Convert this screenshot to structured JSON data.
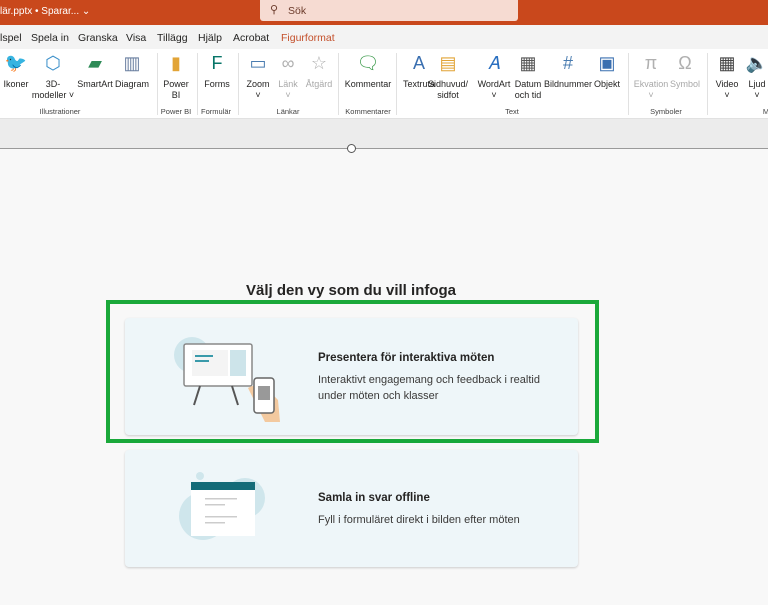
{
  "titlebar": {
    "filename": "lär.pptx • Sparar... ⌄",
    "search_placeholder": "Sök",
    "search_icon": "search-icon"
  },
  "tabs": [
    {
      "label": "lspel"
    },
    {
      "label": "Spela in"
    },
    {
      "label": "Granska"
    },
    {
      "label": "Visa"
    },
    {
      "label": "Tillägg"
    },
    {
      "label": "Hjälp"
    },
    {
      "label": "Acrobat"
    },
    {
      "label": "Figurformat",
      "active": true
    }
  ],
  "ribbon": {
    "buttons": [
      {
        "label": "Ikoner",
        "icon": "icons-icon"
      },
      {
        "label": "3D-",
        "label2": "modeller ˅",
        "icon": "cube-icon"
      },
      {
        "label": "SmartArt",
        "icon": "smartart-icon"
      },
      {
        "label": "Diagram",
        "icon": "chart-icon"
      },
      {
        "label": "Power",
        "label2": "BI",
        "icon": "powerbi-icon"
      },
      {
        "label": "Forms",
        "icon": "forms-icon"
      },
      {
        "label": "Zoom",
        "label2": "˅",
        "icon": "zoom-icon"
      },
      {
        "label": "Länk",
        "label2": "˅",
        "icon": "link-icon",
        "disabled": true
      },
      {
        "label": "Åtgärd",
        "icon": "action-star-icon",
        "disabled": true
      },
      {
        "label": "Kommentar",
        "icon": "comment-icon"
      },
      {
        "label": "Textruta",
        "icon": "textbox-icon"
      },
      {
        "label": "Sidhuvud/",
        "label2": "sidfot",
        "icon": "header-footer-icon"
      },
      {
        "label": "WordArt",
        "label2": "˅",
        "icon": "wordart-icon"
      },
      {
        "label": "Datum",
        "label2": "och tid",
        "icon": "calendar-icon"
      },
      {
        "label": "Bildnummer",
        "icon": "slide-number-icon"
      },
      {
        "label": "Objekt",
        "icon": "object-icon"
      },
      {
        "label": "Ekvation",
        "label2": "˅",
        "icon": "pi-icon",
        "disabled": true
      },
      {
        "label": "Symbol",
        "icon": "omega-icon",
        "disabled": true
      },
      {
        "label": "Video",
        "label2": "˅",
        "icon": "video-icon"
      },
      {
        "label": "Ljud",
        "label2": "˅",
        "icon": "audio-icon"
      }
    ],
    "groups": [
      "Illustrationer",
      "Power BI",
      "Formulär",
      "Länkar",
      "Kommentarer",
      "Text",
      "Symboler",
      "M"
    ]
  },
  "main": {
    "heading": "Välj den vy som du vill infoga",
    "cards": [
      {
        "title": "Presentera för interaktiva möten",
        "desc": "Interaktivt engagemang och feedback i realtid under möten och klasser"
      },
      {
        "title": "Samla in svar offline",
        "desc": "Fyll i formuläret direkt i bilden efter möten"
      }
    ],
    "highlight_color": "#1aa83a"
  }
}
